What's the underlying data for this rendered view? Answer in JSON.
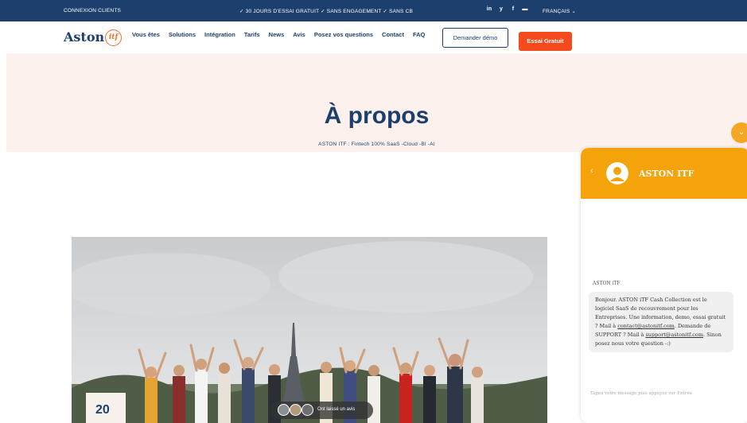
{
  "topbar": {
    "login": "CONNEXION CLIENTS",
    "promo": "✓ 30 JOURS D'ESSAI GRATUIT ✓ SANS ENGAGEMENT ✓ SANS CB",
    "social": [
      "in",
      "y",
      "f",
      "▬"
    ],
    "language": "FRANÇAIS ⌄"
  },
  "nav": {
    "logo_text": "Aston",
    "logo_badge": "itf",
    "links": [
      "Vous êtes",
      "Solutions",
      "Intégration",
      "Tarifs",
      "News",
      "Avis",
      "Posez vos questions",
      "Contact",
      "FAQ"
    ],
    "demo_button": "Demander démo",
    "trial_button": "Essai Gratuit"
  },
  "hero": {
    "title": "À propos",
    "subtitle": "ASTON ITF : Fintech 100% SaaS -Cloud -BI -AI"
  },
  "reviews": {
    "label": "Ont laissé un avis"
  },
  "photo": {
    "banner_text": "20"
  },
  "chat": {
    "toggle_icon": "⌄",
    "back_icon": "‹",
    "name": "ASTON ITF",
    "sender": "ASTON iTF",
    "message_parts": {
      "p1": "Bonjour. ASTON iTF Cash Collection est le logiciel SaaS de recouvrement pour les Entreprises. Une information, demo, essai gratuit ? Mail à ",
      "email1": "contact@astonitf.com",
      "p2": ". Demande de SUPPORT ? Mail à ",
      "email2": "support@astonitf.com",
      "p3": ". Sinon posez nous votre question -:)"
    },
    "input_placeholder": "Tapez votre message puis appuyez sur Entrée"
  },
  "colors": {
    "navy": "#1d3f6e",
    "orange": "#f54a1d",
    "chat_orange": "#f5a30a",
    "hero_bg": "#fdf1ee"
  }
}
